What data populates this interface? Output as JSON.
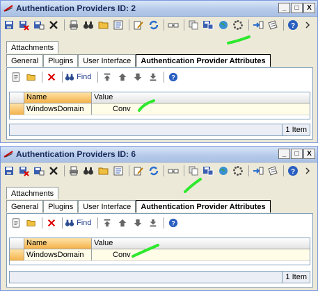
{
  "windows": [
    {
      "title": "Authentication Providers ID: 2",
      "tabs_top": [
        "Attachments"
      ],
      "tabs_bottom": [
        "General",
        "Plugins",
        "User Interface",
        "Authentication Provider Attributes"
      ],
      "find_label": "Find",
      "grid": {
        "columns": [
          "Name",
          "Value"
        ],
        "rows": [
          {
            "name": "WindowsDomain",
            "value": "Conv"
          }
        ]
      },
      "status": "1 Item"
    },
    {
      "title": "Authentication Providers ID: 6",
      "tabs_top": [
        "Attachments"
      ],
      "tabs_bottom": [
        "General",
        "Plugins",
        "User Interface",
        "Authentication Provider Attributes"
      ],
      "find_label": "Find",
      "grid": {
        "columns": [
          "Name",
          "Value"
        ],
        "rows": [
          {
            "name": "WindowsDomain",
            "value": "Conv"
          }
        ]
      },
      "status": "1 Item"
    }
  ],
  "window_buttons": {
    "minimize": "_",
    "maximize": "□",
    "close": "X"
  },
  "colors": {
    "accent": "#f4b24a",
    "highlight_marker": "#2ee82e",
    "title_text": "#1a2a5a"
  }
}
